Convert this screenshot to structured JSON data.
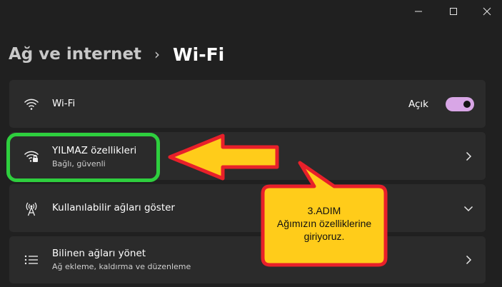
{
  "window": {
    "controls": [
      "minimize",
      "maximize",
      "close"
    ]
  },
  "breadcrumb": {
    "parent": "Ağ ve internet",
    "separator": "›",
    "current": "Wi-Fi"
  },
  "rows": {
    "wifi": {
      "label": "Wi-Fi",
      "toggle_label": "Açık",
      "toggle_on": true,
      "icon": "wifi-icon"
    },
    "network": {
      "title": "YILMAZ özellikleri",
      "subtitle": "Bağlı, güvenli",
      "icon": "wifi-lock-icon"
    },
    "available": {
      "title": "Kullanılabilir ağları göster",
      "icon": "antenna-icon"
    },
    "known": {
      "title": "Bilinen ağları yönet",
      "subtitle": "Ağ ekleme, kaldırma ve düzenleme",
      "icon": "list-icon"
    }
  },
  "annotation": {
    "step": "3.ADIM",
    "line1": "Ağımızın özelliklerine",
    "line2": "giriyoruz."
  },
  "colors": {
    "background": "#202020",
    "card": "#2b2b2b",
    "toggle_on": "#d8a6e6",
    "highlight": "#2ecf3e",
    "arrow_fill": "#ffcc1a",
    "arrow_stroke": "#e8202a"
  }
}
